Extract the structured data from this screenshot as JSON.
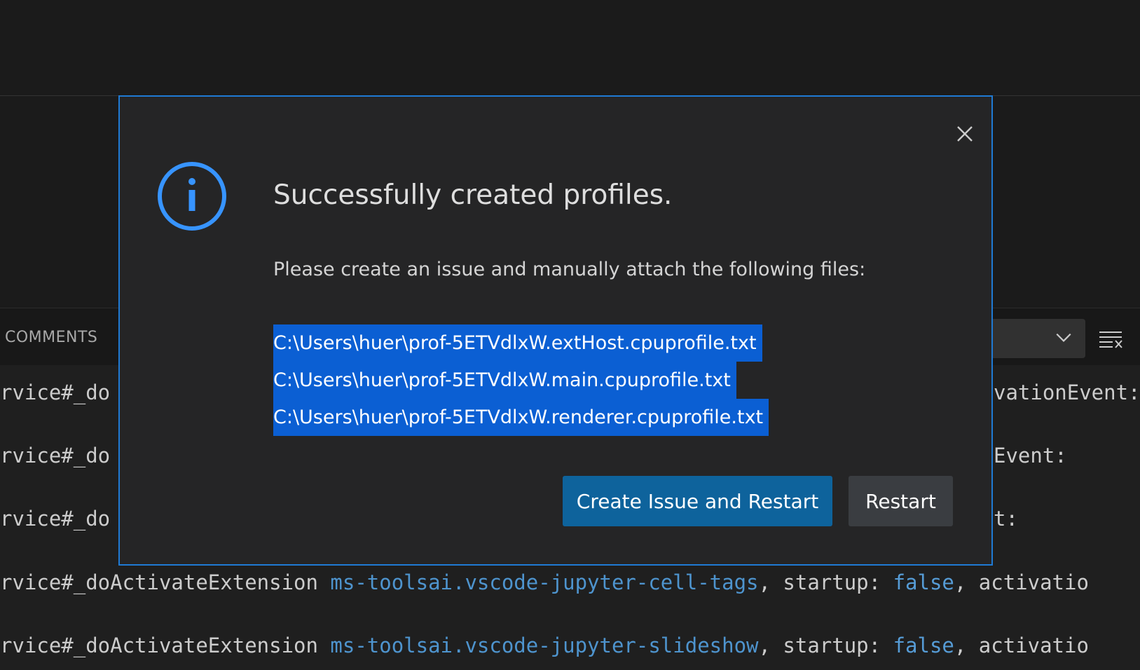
{
  "panel": {
    "tab_label": "COMMENTS"
  },
  "output": {
    "lines": [
      {
        "prefix": "rvice#_do",
        "ext": "",
        "after": "",
        "suffix": "vationEvent:"
      },
      {
        "prefix": "rvice#_do",
        "ext": "",
        "after": "",
        "suffix": "Event:"
      },
      {
        "prefix": "rvice#_do",
        "ext": "",
        "after": "",
        "suffix": "t:"
      },
      {
        "prefix": "rvice#_doActivateExtension ",
        "ext": "ms-toolsai.vscode-jupyter-cell-tags",
        "mid": ", startup: ",
        "kw": "false",
        "after": ", activatio"
      },
      {
        "prefix": "rvice#_doActivateExtension ",
        "ext": "ms-toolsai.vscode-jupyter-slideshow",
        "mid": ", startup: ",
        "kw": "false",
        "after": ", activatio"
      }
    ]
  },
  "dialog": {
    "title": "Successfully created profiles.",
    "message": "Please create an issue and manually attach the following files:",
    "files": [
      "C:\\Users\\huer\\prof-5ETVdlxW.extHost.cpuprofile.txt",
      "C:\\Users\\huer\\prof-5ETVdlxW.main.cpuprofile.txt",
      "C:\\Users\\huer\\prof-5ETVdlxW.renderer.cpuprofile.txt"
    ],
    "primary_button": "Create Issue and Restart",
    "secondary_button": "Restart"
  },
  "colors": {
    "accent": "#1f7ad4",
    "selection": "#0b5fd3",
    "primary_button": "#0e639c",
    "secondary_button": "#3a3d41",
    "info_icon": "#3794ff"
  }
}
